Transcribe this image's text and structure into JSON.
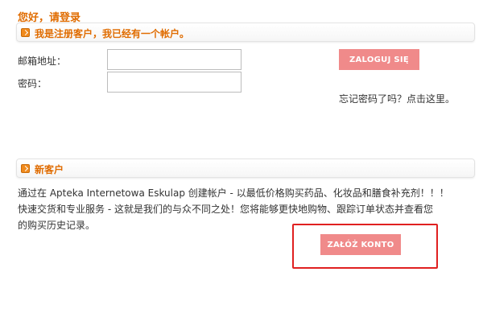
{
  "login": {
    "heading": "您好，请登录",
    "bar_title": "我是注册客户，我已经有一个帐户。",
    "email_label": "邮箱地址：",
    "email_value": "",
    "password_label": "密码：",
    "password_value": "",
    "submit_label": "ZALOGUJ SIĘ",
    "forgot_link": "忘记密码了吗？点击这里。"
  },
  "new_customer": {
    "bar_title": "新客户",
    "text_lines": [
      "通过在 Apteka Internetowa Eskulap 创建帐户 - 以最低价格购买药品、化妆品和膳食补充剂！！！",
      "快速交货和专业服务 - 这就是我们的与众不同之处！您将能够更快地购物、跟踪订单状态并查看您",
      "的购买历史记录。"
    ],
    "create_label": "ZAŁÓŻ KONTO"
  },
  "colors": {
    "accent_orange": "#e06c00",
    "button_pink": "#f08a8a",
    "highlight_red": "#e02020"
  },
  "icons": {
    "section_bar_icon": "orange-arrow-icon"
  }
}
